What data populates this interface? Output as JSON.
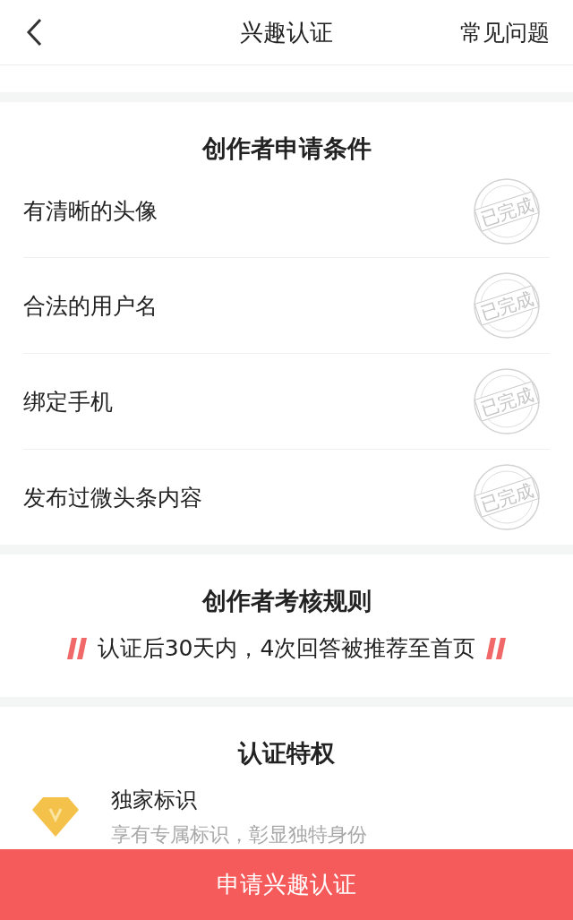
{
  "header": {
    "title": "兴趣认证",
    "action": "常见问题"
  },
  "conditions": {
    "title": "创作者申请条件",
    "items": [
      {
        "label": "有清晰的头像",
        "done": true,
        "stamp": "已完成"
      },
      {
        "label": "合法的用户名",
        "done": true,
        "stamp": "已完成"
      },
      {
        "label": "绑定手机",
        "done": true,
        "stamp": "已完成"
      },
      {
        "label": "发布过微头条内容",
        "done": true,
        "stamp": "已完成"
      }
    ]
  },
  "rules": {
    "title": "创作者考核规则",
    "text": "认证后30天内，4次回答被推荐至首页"
  },
  "privileges": {
    "title": "认证特权",
    "items": [
      {
        "title": "独家标识",
        "description": "享有专属标识，彰显独特身份"
      }
    ]
  },
  "apply_button": "申请兴趣认证"
}
